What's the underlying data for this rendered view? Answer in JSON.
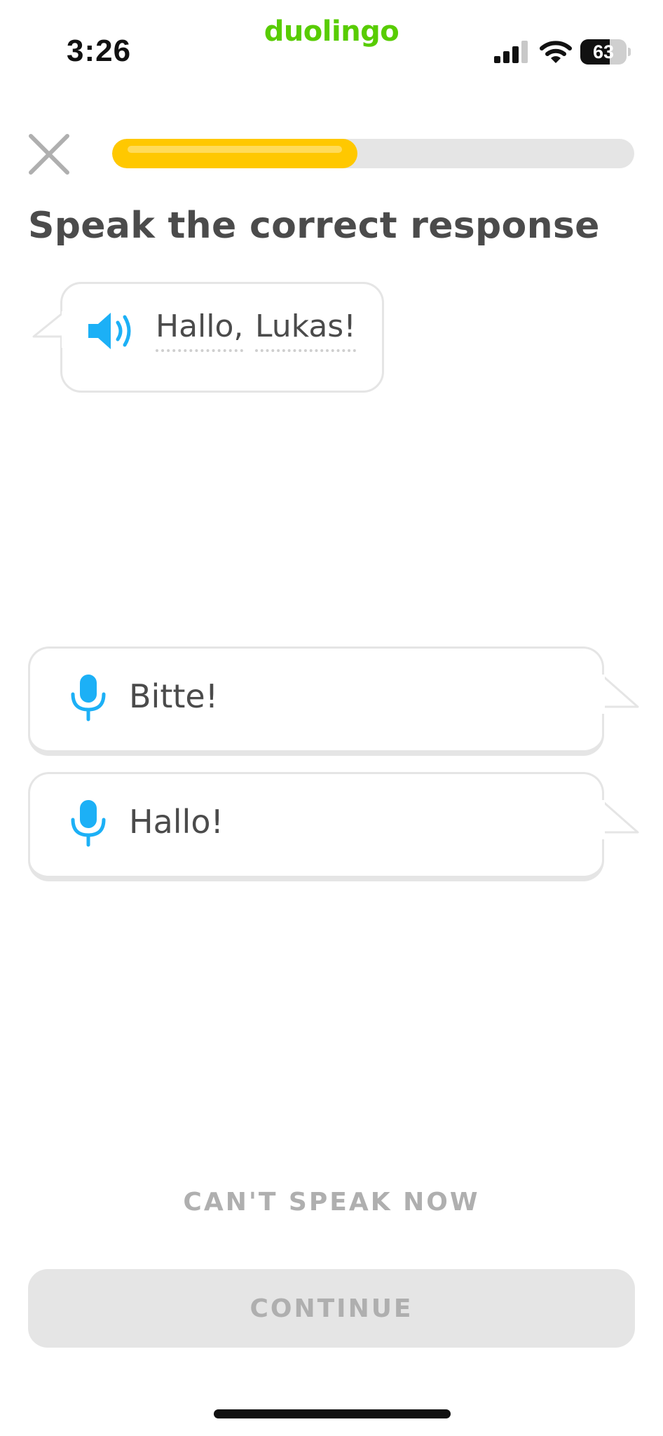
{
  "status_bar": {
    "time": "3:26",
    "brand": "duolingo",
    "battery_percent": 63,
    "battery_label": "63"
  },
  "colors": {
    "brand_green": "#58cc02",
    "progress_yellow": "#ffc800",
    "track_gray": "#e5e5e5",
    "accent_blue": "#1cb0f6",
    "text_dark": "#4b4b4b",
    "text_muted": "#afafaf"
  },
  "lesson": {
    "progress_fraction": 0.47,
    "title": "Speak the correct response",
    "prompt_words": [
      "Hallo,",
      "Lukas!"
    ],
    "options": [
      {
        "label": "Bitte!",
        "icon": "microphone-icon"
      },
      {
        "label": "Hallo!",
        "icon": "microphone-icon"
      }
    ],
    "cant_speak_label": "CAN'T SPEAK NOW",
    "continue_label": "CONTINUE"
  },
  "icons": {
    "close": "close-icon",
    "speaker": "speaker-icon",
    "signal": "signal-icon",
    "wifi": "wifi-icon",
    "battery": "battery-icon"
  }
}
